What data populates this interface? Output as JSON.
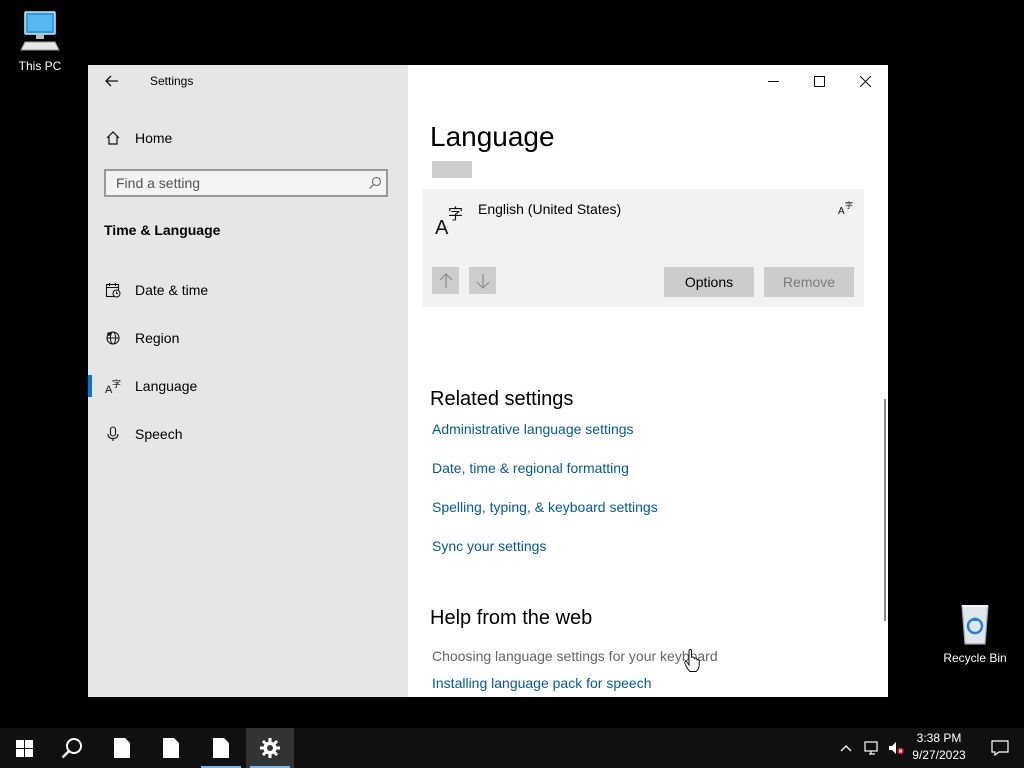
{
  "desktop": {
    "this_pc_label": "This PC",
    "recycle_bin_label": "Recycle Bin"
  },
  "window": {
    "title": "Settings"
  },
  "sidebar": {
    "home_label": "Home",
    "search_placeholder": "Find a setting",
    "group_heading": "Time & Language",
    "items": [
      {
        "label": "Date & time",
        "icon": "calendar-clock-icon"
      },
      {
        "label": "Region",
        "icon": "globe-icon"
      },
      {
        "label": "Language",
        "icon": "language-icon",
        "selected": true
      },
      {
        "label": "Speech",
        "icon": "microphone-icon"
      }
    ]
  },
  "main": {
    "page_title": "Language",
    "language_card": {
      "language_name": "English (United States)",
      "options_label": "Options",
      "remove_label": "Remove"
    },
    "related_settings": {
      "heading": "Related settings",
      "links": [
        "Administrative language settings",
        "Date, time & regional formatting",
        "Spelling, typing, & keyboard settings",
        "Sync your settings"
      ]
    },
    "help": {
      "heading": "Help from the web",
      "items": [
        "Choosing language settings for your keyboard",
        "Installing language pack for speech"
      ]
    }
  },
  "taskbar": {
    "time": "3:38 PM",
    "date": "9/27/2023"
  },
  "colors": {
    "accent": "#0078d7",
    "link": "#005a9e",
    "sidebar_bg": "#e6e6e6",
    "taskbar_bg": "#101010"
  }
}
